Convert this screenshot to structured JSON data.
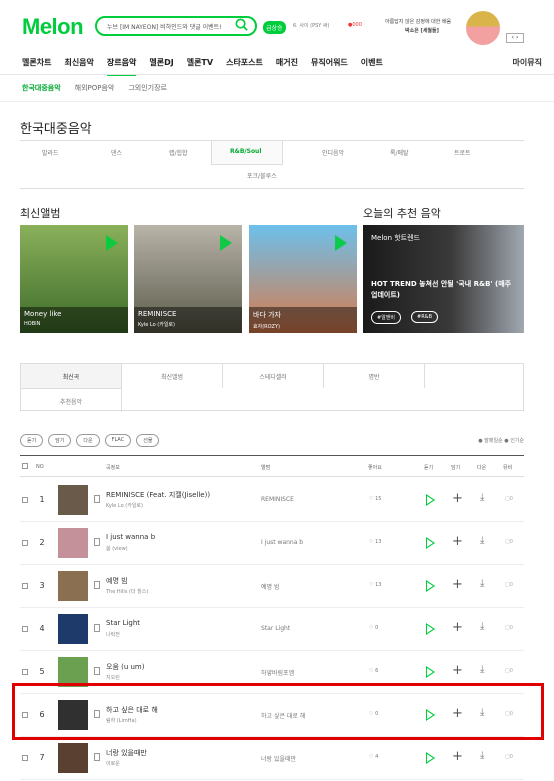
{
  "header": {
    "logo": "Melon",
    "search_text": "누브 [IM NAYEON] 비하인드와 댓글 이벤트!",
    "tag": "급상승",
    "hot1": "6. 사이 (PSY 싸)",
    "hot2": "●000",
    "banner_line1": "아름답지 않은 감정에 대한 배움",
    "banner_line2": "박소은 [세월들]"
  },
  "nav": {
    "items": [
      "멜론차트",
      "최신음악",
      "장르음악",
      "멜론DJ",
      "멜론TV",
      "스타포스트",
      "매거진",
      "뮤직어워드",
      "이벤트"
    ],
    "active": "장르음악",
    "right": "마이뮤직"
  },
  "subnav": {
    "items": [
      "한국대중음악",
      "해외POP음악",
      "그외인기장르"
    ],
    "active": "한국대중음악"
  },
  "page_title": "한국대중음악",
  "genres": [
    "발라드",
    "댄스",
    "랩/힙합",
    "R&B/Soul",
    "인디음악",
    "록/메탈",
    "트로트",
    "포크/블루스"
  ],
  "section": {
    "new_albums": "최신앨범",
    "recommend": "오늘의 추천 음악"
  },
  "albums": [
    {
      "title": "Money like",
      "artist": "HOBIN",
      "color": "#3d6b2a"
    },
    {
      "title": "REMINISCE",
      "artist": "Kyle Lo (카일로)",
      "color": "#7a7a6a"
    },
    {
      "title": "바다 가자",
      "artist": "효자(ROZY)",
      "color": "#4fa4d8"
    }
  ],
  "recommend": {
    "source": "Melon 핫트렌드",
    "text": "HOT TREND 놓쳐선 안될 '국내 R&B' (매주 업데이트)",
    "btn1": "#알앤비",
    "btn2": "#R&B"
  },
  "tabs": [
    "최신곡",
    "최신앨범",
    "스테디셀러",
    "명반",
    "추천음악"
  ],
  "filters": [
    "듣기",
    "담기",
    "다운",
    "FLAC",
    "선물"
  ],
  "sort": "● 발매일순  ● 인기순",
  "table_header": {
    "no": "NO",
    "song": "곡정보",
    "album": "앨범",
    "like": "좋아요",
    "play": "듣기",
    "add": "담기",
    "down": "다운",
    "mv": "뮤비"
  },
  "songs": [
    {
      "no": "1",
      "title": "REMINISCE (Feat. 지젤(Jiselle))",
      "artist": "Kyle Lo (카일로)",
      "album": "REMINISCE",
      "likes": "♡ 15",
      "color": "#6a5a4a"
    },
    {
      "no": "2",
      "title": "I just wanna b",
      "artist": "봄 (view)",
      "album": "I just wanna b",
      "likes": "♡ 13",
      "color": "#c4909a"
    },
    {
      "no": "3",
      "title": "예명 빔",
      "artist": "The Hills (더 힐스)",
      "album": "예명 빔",
      "likes": "♡ 13",
      "color": "#8a7050"
    },
    {
      "no": "4",
      "title": "Star Light",
      "artist": "나락전",
      "album": "Star Light",
      "likes": "♡ 0",
      "color": "#1e3a6a"
    },
    {
      "no": "5",
      "title": "오움 (u um)",
      "artist": "지오린",
      "album": "하얗바림포엠",
      "likes": "♡ 6",
      "color": "#6aa050"
    },
    {
      "no": "6",
      "title": "하고 싶은 대로 해",
      "artist": "림하 (LimHa)",
      "album": "하고 싶은 대로 해",
      "likes": "♡ 0",
      "color": "#303030"
    },
    {
      "no": "7",
      "title": "너랑 있을때만",
      "artist": "이로운",
      "album": "너랑 있을때만",
      "likes": "♡ 4",
      "color": "#5a4030"
    }
  ],
  "mv_label": "0"
}
